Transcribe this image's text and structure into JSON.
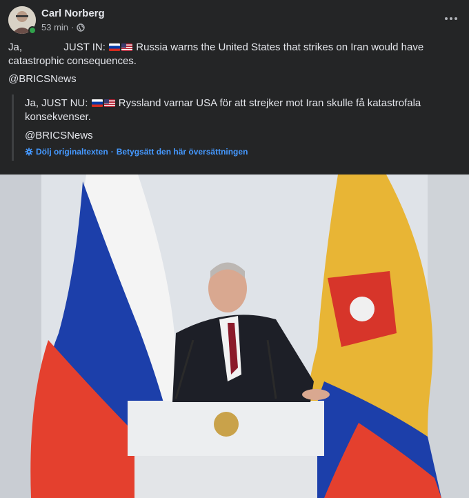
{
  "post": {
    "author": "Carl Norberg",
    "time": "53 min",
    "separator": "·",
    "text_prefix": "Ja,",
    "text_main": "JUST IN:",
    "text_after_flags": "Russia warns the United States that strikes on Iran would have",
    "text_line2": "catastrophic consequences.",
    "handle": "@BRICSNews"
  },
  "translation": {
    "text_prefix": "Ja, JUST NU:",
    "text_after_flags": "Ryssland varnar USA för att strejker mot Iran skulle få katastrofala",
    "text_line2": "konsekvenser.",
    "handle": "@BRICSNews",
    "hide_original": "Dölj originaltexten",
    "dot": "·",
    "rate": "Betygsätt den här översättningen"
  },
  "colors": {
    "background": "#242526",
    "text": "#e4e6eb",
    "secondary": "#b0b3b8",
    "link": "#4599ff",
    "online": "#31a24c"
  },
  "icons": [
    "avatar",
    "online-status-dot",
    "globe-icon",
    "more-options-icon",
    "translate-gear-icon",
    "flag-russia-icon",
    "flag-usa-icon"
  ]
}
